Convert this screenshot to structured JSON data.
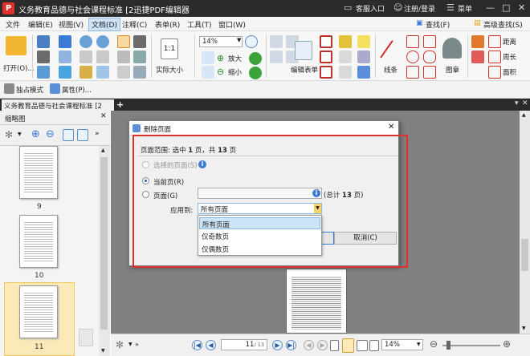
{
  "titlebar": {
    "logo": "P",
    "title": "义务教育品德与社会课程标准 [2迅捷PDF编辑器",
    "customer_login": "客服入口",
    "register_login": "注册/登录",
    "menu": "菜单"
  },
  "menubar": {
    "items": [
      "文件",
      "编辑(E)",
      "视图(V)",
      "文档(D)",
      "注释(C)",
      "表单(R)",
      "工具(T)",
      "窗口(W)"
    ],
    "active_index": 3,
    "find": "查找(F)",
    "advanced_find": "高级查找(S)"
  },
  "ribbon": {
    "open_label": "打开(O)...",
    "zoom_value": "14%",
    "zoom_in": "放大",
    "zoom_out": "缩小",
    "actual_size": "实际大小",
    "actual_size_icon_text": "1:1",
    "edit_form": "编辑表单",
    "lines": "线条",
    "shapes": "图章",
    "distance": "距离",
    "perimeter": "周长",
    "area": "面积"
  },
  "toolbar2": {
    "exclusive_mode": "独占模式",
    "properties": "属性(P)..."
  },
  "tab": {
    "title": "义务教育品德与社会课程标准 [2"
  },
  "left_panel": {
    "title": "缩略图",
    "thumbnails": [
      {
        "page": "9"
      },
      {
        "page": "10"
      },
      {
        "page": "11"
      }
    ],
    "selected_page": "11"
  },
  "dialog": {
    "title": "删除页面",
    "range_prefix": "页面范围: 选中 ",
    "range_selected": "1",
    "range_mid": " 页，共 ",
    "range_total": "13",
    "range_suffix": " 页",
    "option_selected_pages": "选择的页面(S)",
    "option_current_page": "当前页(R)",
    "option_pages": "页面(G)",
    "pages_input_value": "",
    "total_prefix": "(总计 ",
    "total_count": "13",
    "total_suffix": " 页)",
    "apply_to_label": "应用到:",
    "apply_to_value": "所有页面",
    "ok_button": "确定",
    "cancel_button": "取消(C)",
    "dropdown_options": [
      "所有页面",
      "仅奇数页",
      "仅偶数页"
    ],
    "dropdown_selected_index": 0
  },
  "bottombar": {
    "page_value": "11",
    "page_total": "/ 13",
    "zoom_value": "14%"
  },
  "colors": {
    "highlight_border": "#e0302a",
    "title_bg": "#2b2b2b",
    "active_menu_bg": "#cfe3f7"
  }
}
